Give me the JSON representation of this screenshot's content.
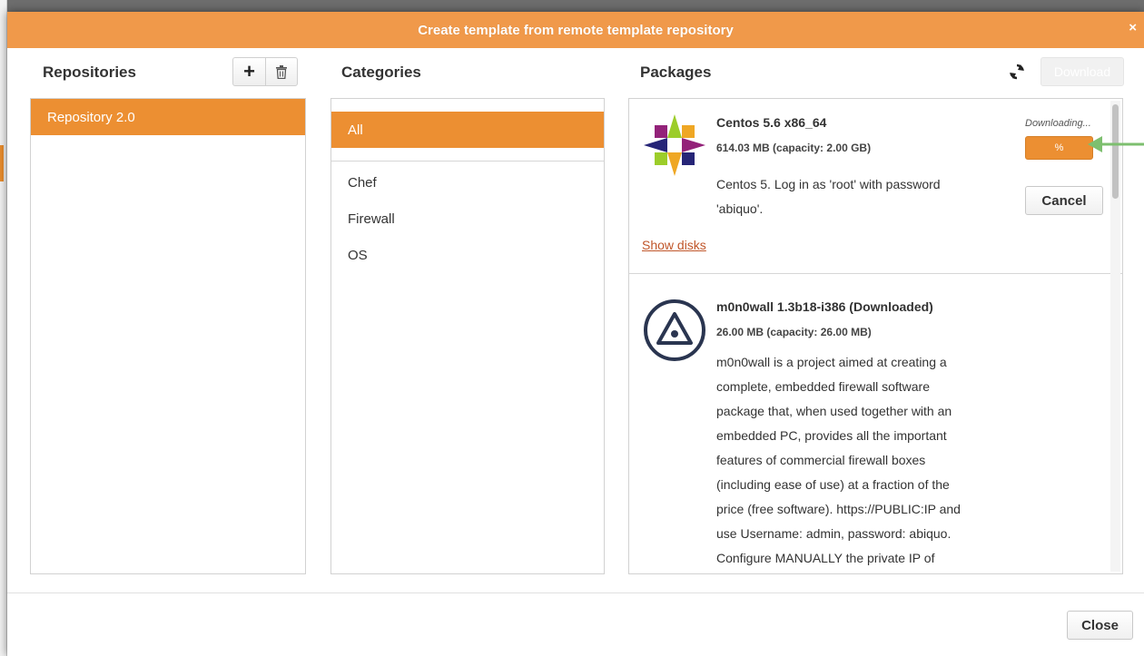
{
  "dialog": {
    "title": "Create template from remote template repository",
    "close_glyph": "×"
  },
  "repositories": {
    "header": "Repositories",
    "add_glyph": "+",
    "items": [
      {
        "label": "Repository 2.0",
        "selected": true
      }
    ]
  },
  "categories": {
    "header": "Categories",
    "items": [
      {
        "label": "All",
        "selected": true
      },
      {
        "label": "Chef"
      },
      {
        "label": "Firewall"
      },
      {
        "label": "OS"
      }
    ]
  },
  "packages": {
    "header": "Packages",
    "download_label": "Download",
    "items": [
      {
        "name": "Centos 5.6 x86_64",
        "size": "614.03 MB (capacity: 2.00 GB)",
        "description_lines": [
          "Centos 5. Log in as 'root' with password",
          "'abiquo'."
        ],
        "status": "Downloading...",
        "progress_text": "%",
        "cancel_label": "Cancel",
        "show_disks_label": "Show disks",
        "icon": "centos-logo-icon"
      },
      {
        "name": "m0n0wall 1.3b18-i386 (Downloaded)",
        "size": "26.00 MB (capacity: 26.00 MB)",
        "description_lines": [
          "m0n0wall is a project aimed at creating a",
          "complete, embedded firewall software",
          "package that, when used together with an",
          "embedded PC, provides all the important",
          "features of commercial firewall boxes",
          "(including ease of use) at a fraction of the",
          "price (free software). https://PUBLIC:IP and",
          "use Username: admin, password: abiquo.",
          "Configure MANUALLY the private IP of"
        ],
        "icon": "m0n0wall-logo-icon"
      }
    ]
  },
  "footer": {
    "close_label": "Close"
  },
  "colors": {
    "accent": "#ec8f32",
    "titlebar": "#f0994a",
    "annotation_arrow": "#7dbf6f"
  }
}
